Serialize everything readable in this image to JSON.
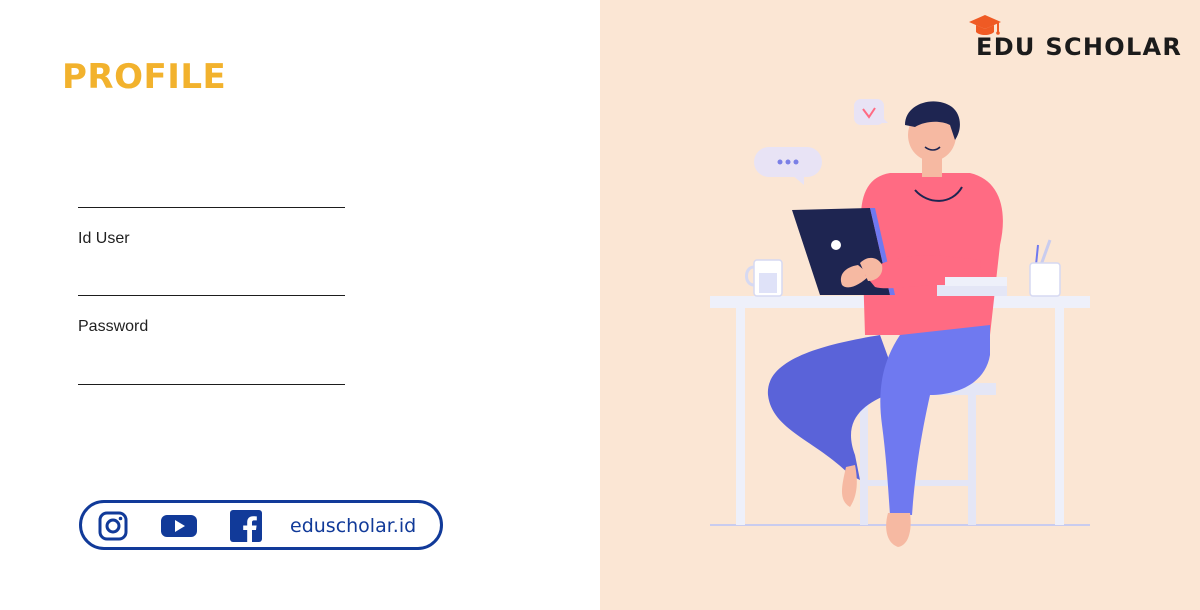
{
  "profile": {
    "title": "PROFILE",
    "fields": [
      {
        "label": "Id User"
      },
      {
        "label": "Password"
      }
    ]
  },
  "social": {
    "icons": [
      "instagram-icon",
      "youtube-icon",
      "facebook-icon"
    ],
    "website": "eduscholar.id",
    "color": "#113a99"
  },
  "brand": {
    "name": "EDU SCHOLAR",
    "icon": "graduation-cap-icon",
    "accent": "#ef5a24"
  },
  "colors": {
    "title": "#f2b22d",
    "panel_background": "#fbe6d4",
    "shirt": "#ff6b83",
    "pants": "#6f79f0",
    "desk": "#eef0fa"
  }
}
